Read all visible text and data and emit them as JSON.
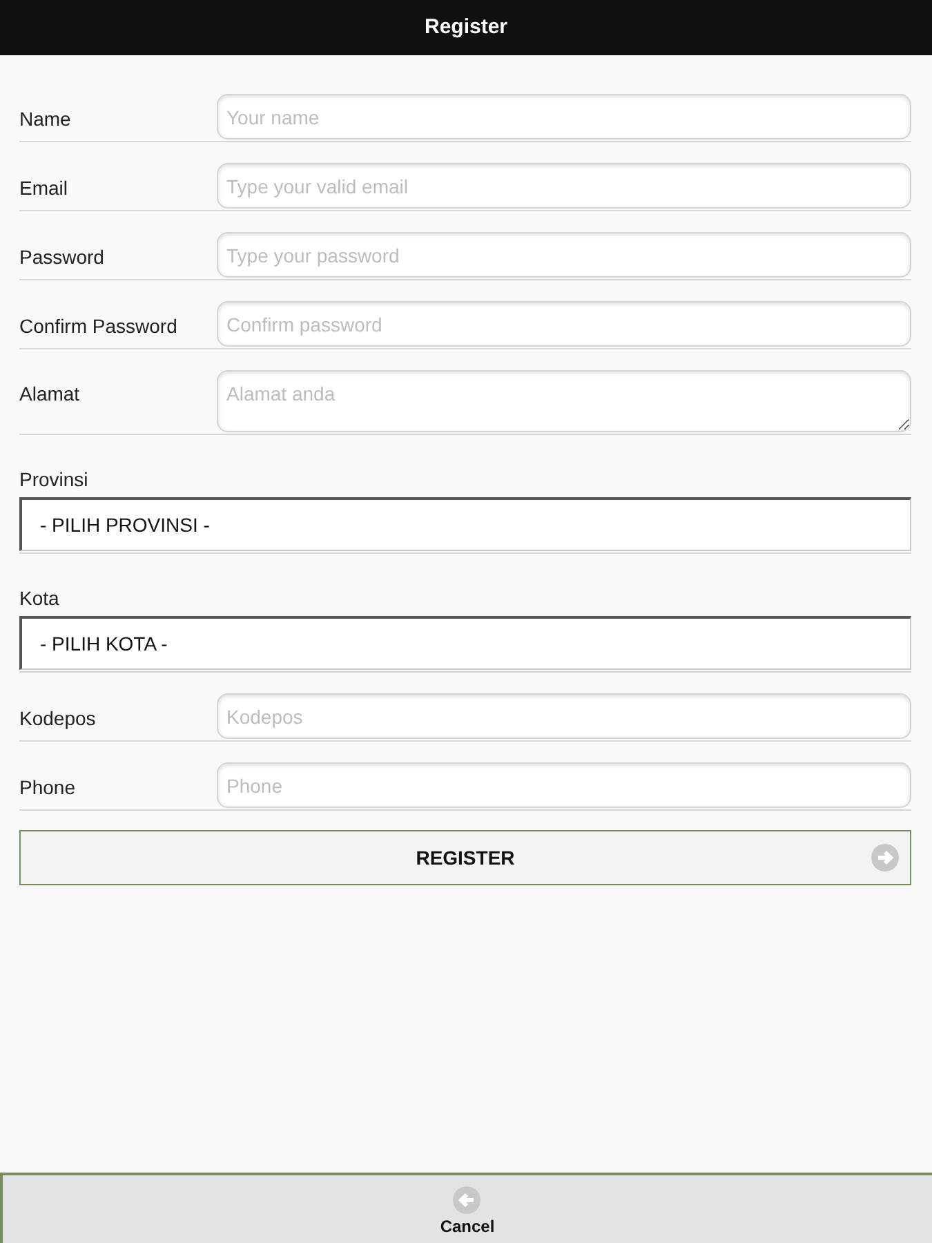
{
  "header": {
    "title": "Register"
  },
  "fields": [
    {
      "kind": "text",
      "label": "Name",
      "placeholder": "Your name"
    },
    {
      "kind": "text",
      "label": "Email",
      "placeholder": "Type your valid email"
    },
    {
      "kind": "text",
      "label": "Password",
      "placeholder": "Type your password"
    },
    {
      "kind": "text",
      "label": "Confirm Password",
      "placeholder": "Confirm password"
    },
    {
      "kind": "textarea",
      "label": "Alamat",
      "placeholder": "Alamat anda"
    },
    {
      "kind": "select",
      "label": "Provinsi",
      "value": "- PILIH PROVINSI -"
    },
    {
      "kind": "select",
      "label": "Kota",
      "value": "- PILIH KOTA -"
    },
    {
      "kind": "text",
      "label": "Kodepos",
      "placeholder": "Kodepos"
    },
    {
      "kind": "text",
      "label": "Phone",
      "placeholder": "Phone"
    }
  ],
  "submit": {
    "label": "REGISTER"
  },
  "footer": {
    "cancel": "Cancel"
  }
}
